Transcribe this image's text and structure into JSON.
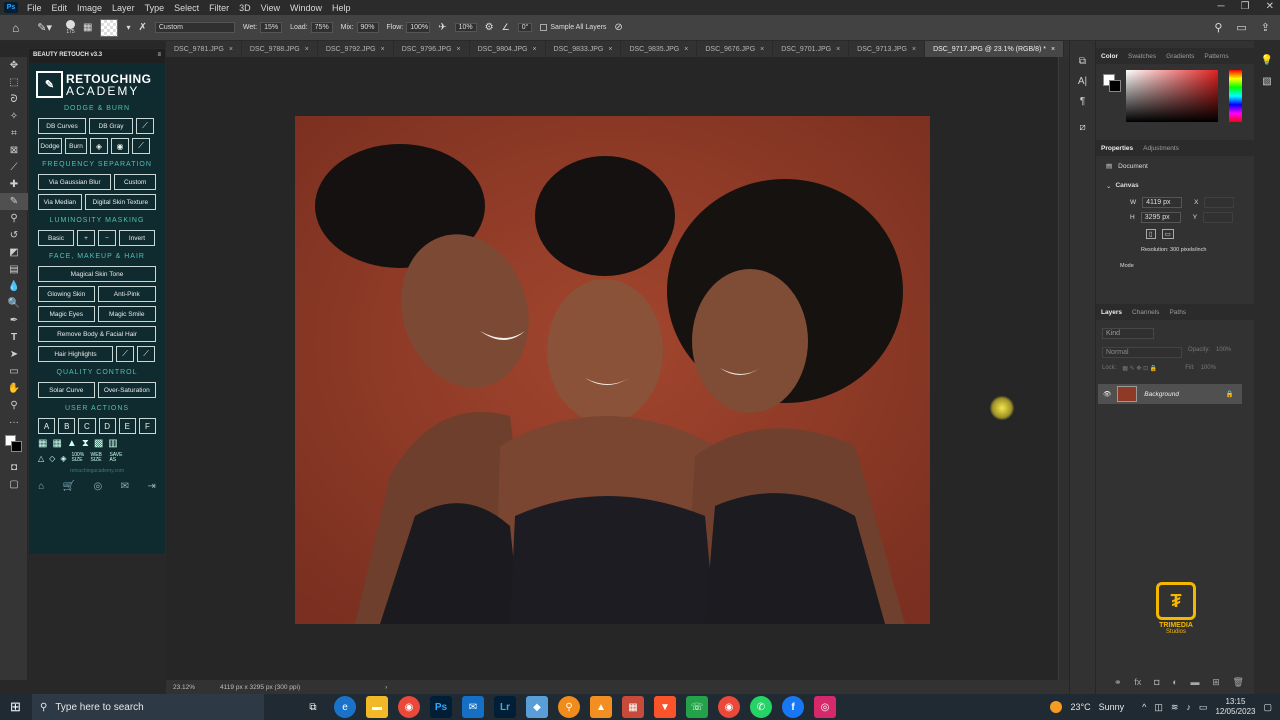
{
  "menubar": {
    "items": [
      "File",
      "Edit",
      "Image",
      "Layer",
      "Type",
      "Select",
      "Filter",
      "3D",
      "View",
      "Window",
      "Help"
    ]
  },
  "options": {
    "brush_size": "175",
    "mode": "Custom",
    "wet_label": "Wet:",
    "wet": "15%",
    "load_label": "Load:",
    "load": "75%",
    "mix_label": "Mix:",
    "mix": "90%",
    "flow_label": "Flow:",
    "flow": "100%",
    "smoothing": "10%",
    "angle": "0°",
    "sample_all_layers": "Sample All Layers"
  },
  "tabs": [
    {
      "label": "DSC_9781.JPG"
    },
    {
      "label": "DSC_9788.JPG"
    },
    {
      "label": "DSC_9792.JPG"
    },
    {
      "label": "DSC_9796.JPG"
    },
    {
      "label": "DSC_9804.JPG"
    },
    {
      "label": "DSC_9833.JPG"
    },
    {
      "label": "DSC_9835.JPG"
    },
    {
      "label": "DSC_9676.JPG"
    },
    {
      "label": "DSC_9701.JPG"
    },
    {
      "label": "DSC_9713.JPG"
    },
    {
      "label": "DSC_9717.JPG @ 23.1% (RGB/8) *",
      "active": true
    }
  ],
  "plugin": {
    "title": "BEAUTY RETOUCH v3.3",
    "logo_line1": "RETOUCHING",
    "logo_line2": "ACADEMY",
    "sections": {
      "dodge_burn": "DODGE & BURN",
      "freq_sep": "FREQUENCY SEPARATION",
      "lum_mask": "LUMINOSITY MASKING",
      "face": "FACE, MAKEUP & HAIR",
      "quality": "QUALITY CONTROL",
      "user": "USER ACTIONS"
    },
    "buttons": {
      "db_curves": "DB Curves",
      "db_gray": "DB Gray",
      "dodge": "Dodge",
      "burn": "Burn",
      "via_gaussian": "Via Gaussian Blur",
      "custom": "Custom",
      "via_median": "Via Median",
      "digital_skin": "Digital Skin Texture",
      "basic": "Basic",
      "plus": "+",
      "minus": "−",
      "invert": "Invert",
      "magical_skin": "Magical Skin Tone",
      "glowing_skin": "Glowing Skin",
      "anti_pink": "Anti-Pink",
      "magic_eyes": "Magic Eyes",
      "magic_smile": "Magic Smile",
      "remove_body": "Remove Body & Facial Hair",
      "hair_highlights": "Hair Highlights",
      "solar_curve": "Solar Curve",
      "over_saturation": "Over-Saturation"
    },
    "user_actions": [
      "A",
      "B",
      "C",
      "D",
      "E",
      "F"
    ],
    "icon_labels": {
      "size": "100% SIZE",
      "web": "WEB SIZE",
      "save": "SAVE AS"
    },
    "url": "retouchingacademy.com"
  },
  "statusbar": {
    "zoom": "23.12%",
    "doc": "4119 px x 3295 px (300 ppi)"
  },
  "panels": {
    "color_tabs": [
      "Color",
      "Swatches",
      "Gradients",
      "Patterns"
    ],
    "props_tabs": [
      "Properties",
      "Adjustments"
    ],
    "document_label": "Document",
    "canvas_label": "Canvas",
    "w_label": "W",
    "w_value": "4119 px",
    "h_label": "H",
    "h_value": "3295 px",
    "x_label": "X",
    "y_label": "Y",
    "resolution": "Resolution: 300 pixels/inch",
    "mode_label": "Mode",
    "layers_tabs": [
      "Layers",
      "Channels",
      "Paths"
    ],
    "kind_placeholder": "Kind",
    "blend_mode": "Normal",
    "opacity_label": "Opacity:",
    "opacity": "100%",
    "lock_label": "Lock:",
    "fill_label": "Fill:",
    "fill": "100%",
    "layer_name": "Background"
  },
  "watermark": {
    "name": "TRIMEDIA",
    "sub": "Studios"
  },
  "taskbar": {
    "search_placeholder": "Type here to search",
    "weather_temp": "23°C",
    "weather_cond": "Sunny",
    "time": "13:15",
    "date": "12/05/2023"
  },
  "colors": {
    "plugin_bg": "#0f2b2f",
    "plugin_accent": "#4fc0b4",
    "backdrop": "#8e3a27",
    "watermark": "#f5b800"
  }
}
